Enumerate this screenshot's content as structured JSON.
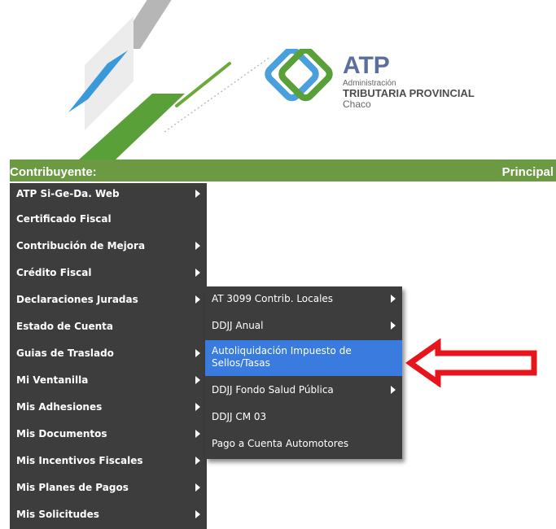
{
  "header": {
    "logo": {
      "title": "ATP",
      "line1": "Administración",
      "line2": "TRIBUTARIA PROVINCIAL",
      "line3": "Chaco"
    }
  },
  "greenbar": {
    "left_label": "Contribuyente:",
    "right_label": "Principal"
  },
  "menu_main": {
    "items": [
      {
        "label": "ATP Si-Ge-Da. Web",
        "submenu": true
      },
      {
        "label": "Certificado Fiscal",
        "submenu": false
      },
      {
        "label": "Contribución de  Mejora",
        "submenu": true
      },
      {
        "label": "Crédito Fiscal",
        "submenu": true
      },
      {
        "label": "Declaraciones Juradas",
        "submenu": true
      },
      {
        "label": "Estado de Cuenta",
        "submenu": false
      },
      {
        "label": "Guias de Traslado",
        "submenu": true
      },
      {
        "label": "Mi Ventanilla",
        "submenu": true
      },
      {
        "label": "Mis Adhesiones",
        "submenu": true
      },
      {
        "label": "Mis Documentos",
        "submenu": true
      },
      {
        "label": "Mis Incentivos Fiscales",
        "submenu": true
      },
      {
        "label": "Mis Planes de Pagos",
        "submenu": true
      },
      {
        "label": "Mis Solicitudes",
        "submenu": true
      }
    ]
  },
  "menu_declaraciones": {
    "items": [
      {
        "label": "AT 3099 Contrib. Locales",
        "submenu": true
      },
      {
        "label": "DDJJ Anual",
        "submenu": true
      },
      {
        "label": "Autoliquidación Impuesto de Sellos/Tasas",
        "submenu": false,
        "highlighted": true
      },
      {
        "label": "DDJJ Fondo Salud Pública",
        "submenu": true
      },
      {
        "label": "DDJJ CM 03",
        "submenu": false
      },
      {
        "label": "Pago a Cuenta Automotores",
        "submenu": false
      }
    ]
  },
  "colors": {
    "green_bar": "#6b9a43",
    "menu_bg": "#3d3d3d",
    "highlight": "#3a7be0",
    "callout_arrow": "#e8141c"
  }
}
